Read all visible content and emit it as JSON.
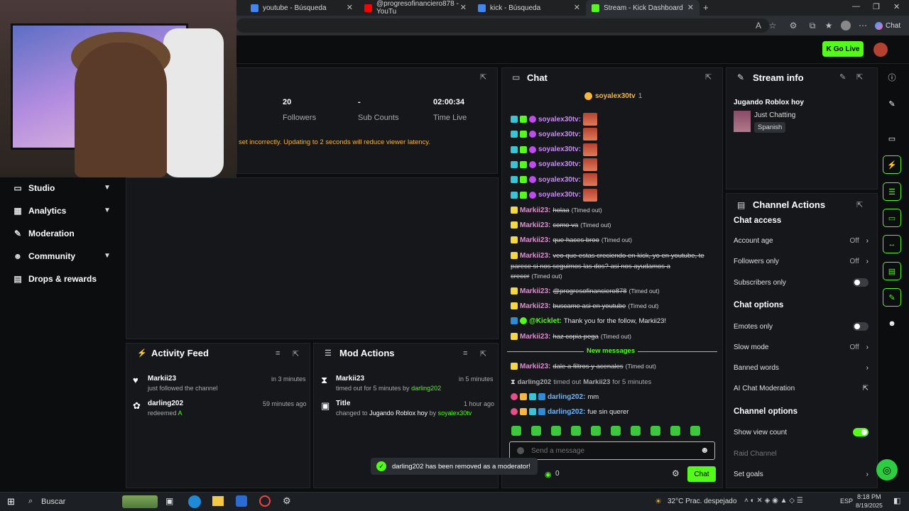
{
  "browser": {
    "tabs": [
      {
        "label": "youtube - Búsqueda",
        "active": false
      },
      {
        "label": "@progresofinanciero878 - YouTu",
        "active": false
      },
      {
        "label": "kick - Búsqueda",
        "active": false
      },
      {
        "label": "Stream - Kick Dashboard",
        "active": true
      }
    ],
    "chat_button": "Chat",
    "accent": "#53fc18"
  },
  "topbar": {
    "go_live": "Go Live"
  },
  "stats": [
    {
      "value": "20",
      "label": "Followers"
    },
    {
      "value": "-",
      "label": "Sub Counts"
    },
    {
      "value": "02:00:34",
      "label": "Time Live"
    }
  ],
  "latency_warning": "set incorrectly. Updating to 2 seconds will reduce viewer latency.",
  "sidebar": {
    "items": [
      {
        "label": "Studio",
        "icon": "studio-icon",
        "chevron": true
      },
      {
        "label": "Analytics",
        "icon": "analytics-icon",
        "chevron": true
      },
      {
        "label": "Moderation",
        "icon": "moderation-icon",
        "chevron": false
      },
      {
        "label": "Community",
        "icon": "community-icon",
        "chevron": true
      },
      {
        "label": "Drops & rewards",
        "icon": "drops-icon",
        "chevron": false
      }
    ]
  },
  "activity_feed": {
    "title": "Activity Feed",
    "items": [
      {
        "name": "Markii23",
        "detail": "just followed the channel",
        "time": "in 3 minutes"
      },
      {
        "name": "darling202",
        "detail": "redeemed",
        "reward": "A",
        "time": "59 minutes ago"
      }
    ]
  },
  "mod_actions": {
    "title": "Mod Actions",
    "items": [
      {
        "name": "Markii23",
        "detail": "timed out for 5 minutes by",
        "actor": "darling202",
        "time": "in 5 minutes"
      },
      {
        "name": "Title",
        "detail": "changed to",
        "value": "Jugando Roblox hoy",
        "by": "by",
        "actor": "soyalex30tv",
        "time": "1 hour ago"
      }
    ]
  },
  "chat": {
    "title": "Chat",
    "pinned_user": "soyalex30tv",
    "pinned_count": "1",
    "soyalex_user": "soyalex30tv:",
    "soyalex_count": 6,
    "messages": [
      {
        "user": "Markii23:",
        "text": "holaa",
        "timed_out": "(Timed out)"
      },
      {
        "user": "Markii23:",
        "text": "como va",
        "timed_out": "(Timed out)"
      },
      {
        "user": "Markii23:",
        "text": "que haces broo",
        "timed_out": "(Timed out)"
      },
      {
        "user": "Markii23:",
        "text": "veo que estas creciendo en kick, yo en youtube, te",
        "text2": "parece si nos seguimos las dos? asi nos ayudamos a",
        "text3": "crecer",
        "timed_out": "(Timed out)"
      },
      {
        "user": "Markii23:",
        "text": "@progresofinanciero878",
        "timed_out": "(Timed out)"
      },
      {
        "user": "Markii23:",
        "text": "buscame asi en youtube",
        "timed_out": "(Timed out)"
      },
      {
        "user": "@Kicklet:",
        "text": "Thank you for the follow, Markii23!"
      },
      {
        "user": "Markii23:",
        "text": "haz copia pega",
        "timed_out": "(Timed out)"
      }
    ],
    "new_messages": "New messages",
    "after": [
      {
        "user": "Markii23:",
        "text": "dale a filtros y acenales",
        "timed_out": "(Timed out)"
      },
      {
        "system": "darling202 timed out Markii23 for 5 minutes",
        "user": "darling202",
        "mid": "timed out",
        "target": "Markii23",
        "end": "for 5 minutes"
      },
      {
        "user": "darling202:",
        "text": "mm"
      },
      {
        "user": "darling202:",
        "text": "fue sin querer"
      }
    ],
    "placeholder": "Send a message",
    "points": "0",
    "send": "Chat"
  },
  "toast": "darling202 has been removed as a moderator!",
  "stream_info": {
    "title": "Stream info",
    "stream_title": "Jugando Roblox hoy",
    "category": "Just Chatting",
    "language": "Spanish"
  },
  "channel_actions": {
    "title": "Channel Actions",
    "partial_top": "Chat access",
    "rows1": [
      {
        "label": "Account age",
        "value": "Off",
        "type": "chevron"
      },
      {
        "label": "Followers only",
        "value": "Off",
        "type": "chevron"
      },
      {
        "label": "Subscribers only",
        "type": "toggle",
        "on": false
      }
    ],
    "chat_options": "Chat options",
    "rows2": [
      {
        "label": "Emotes only",
        "type": "toggle",
        "on": false
      },
      {
        "label": "Slow mode",
        "value": "Off",
        "type": "chevron"
      },
      {
        "label": "Banned words",
        "type": "chevron"
      },
      {
        "label": "AI Chat Moderation",
        "type": "external"
      }
    ],
    "channel_options": "Channel options",
    "rows3": [
      {
        "label": "Show view count",
        "type": "toggle",
        "on": true
      },
      {
        "label": "Raid Channel",
        "type": "disabled"
      },
      {
        "label": "Set goals",
        "type": "chevron"
      }
    ]
  },
  "taskbar": {
    "search": "Buscar",
    "weather": "32°C  Prac. despejado",
    "lang": "ESP",
    "time": "8:18 PM",
    "date": "8/19/2025"
  }
}
